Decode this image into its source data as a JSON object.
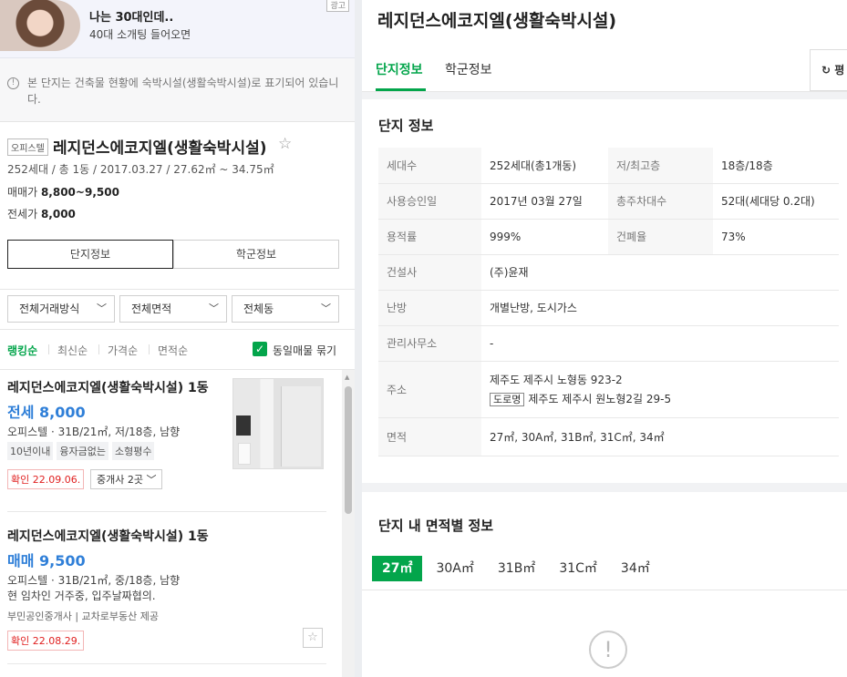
{
  "ad": {
    "title": "나는 30대인데..",
    "subtitle": "40대 소개팅 들어오면",
    "badge": "광고"
  },
  "notice": {
    "icon": "info-icon",
    "text": "본 단지는 건축물 현황에 숙박시설(생활숙박시설)로 표기되어 있습니다."
  },
  "complex": {
    "type_badge": "오피스텔",
    "name": "레지던스에코지엘(생활숙박시설)",
    "meta": "252세대 / 총 1동 / 2017.03.27 / 27.62㎡ ~ 34.75㎡",
    "sale_label": "매매가",
    "sale_value": "8,800~9,500",
    "lease_label": "전세가",
    "lease_value": "8,000",
    "tabs": [
      "단지정보",
      "학군정보"
    ]
  },
  "filters": [
    "전체거래방식",
    "전체면적",
    "전체동"
  ],
  "sort": {
    "options": [
      "랭킹순",
      "최신순",
      "가격순",
      "면적순"
    ],
    "same_listing_label": "동일매물 묶기"
  },
  "listings": [
    {
      "title": "레지던스에코지엘(생활숙박시설) 1동",
      "price": "전세 8,000",
      "detail": "오피스텔 · 31B/21㎡, 저/18층, 남향",
      "tags": [
        "10년이내",
        "융자금없는",
        "소형평수"
      ],
      "confirmed": "확인 22.09.06.",
      "brokers": "중개사 2곳"
    },
    {
      "title": "레지던스에코지엘(생활숙박시설) 1동",
      "price": "매매 9,500",
      "detail": "오피스텔 · 31B/21㎡, 중/18층, 남향",
      "desc": "현 임차인 거주중, 입주날짜협의.",
      "agent": "부민공인중개사 | 교차로부동산 제공",
      "confirmed": "확인 22.08.29."
    }
  ],
  "right": {
    "title": "레지던스에코지엘(생활숙박시설)",
    "tabs": [
      "단지정보",
      "학군정보"
    ],
    "side_button": "평",
    "info_title": "단지 정보",
    "info": {
      "households_k": "세대수",
      "households_v": "252세대(총1개동)",
      "floors_k": "저/최고층",
      "floors_v": "18층/18층",
      "approval_k": "사용승인일",
      "approval_v": "2017년 03월 27일",
      "parking_k": "총주차대수",
      "parking_v": "52대(세대당 0.2대)",
      "far_k": "용적률",
      "far_v": "999%",
      "bcr_k": "건폐율",
      "bcr_v": "73%",
      "builder_k": "건설사",
      "builder_v": "(주)윤재",
      "heating_k": "난방",
      "heating_v": "개별난방, 도시가스",
      "office_k": "관리사무소",
      "office_v": "-",
      "address_k": "주소",
      "address_v1": "제주도 제주시 노형동 923-2",
      "road_tag": "도로명",
      "address_v2": "제주도 제주시 원노형2길 29-5",
      "area_k": "면적",
      "area_v": "27㎡, 30A㎡, 31B㎡, 31C㎡, 34㎡"
    },
    "area_title": "단지 내 면적별 정보",
    "area_tabs": [
      "27㎡",
      "30A㎡",
      "31B㎡",
      "31C㎡",
      "34㎡"
    ]
  }
}
